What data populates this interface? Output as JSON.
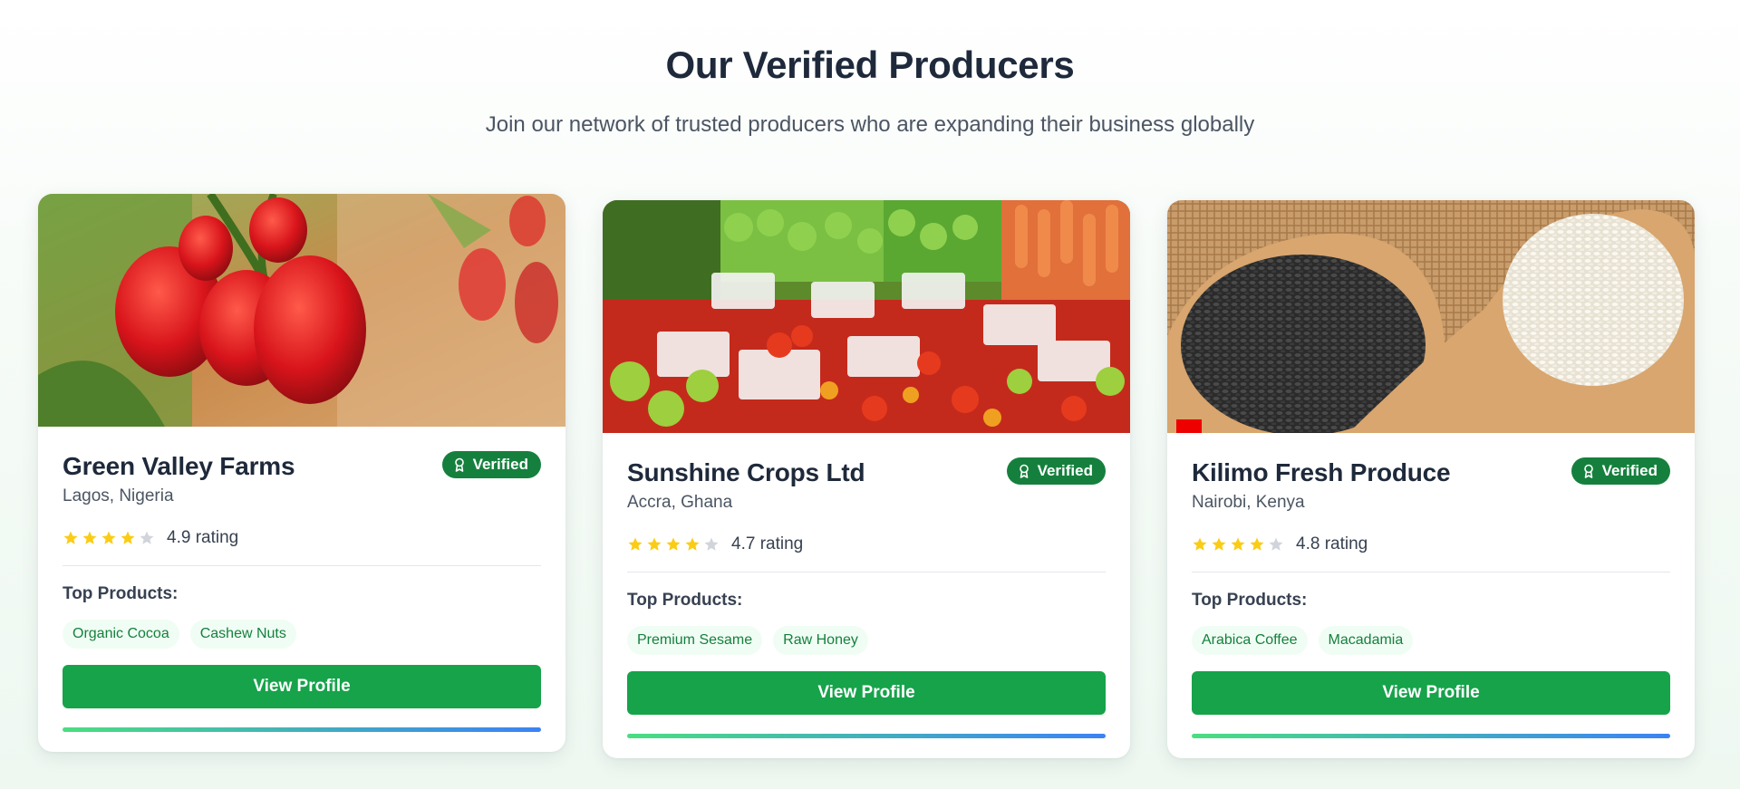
{
  "section": {
    "title": "Our Verified Producers",
    "subtitle": "Join our network of trusted producers who are expanding their business globally"
  },
  "producers": [
    {
      "name": "Green Valley Farms",
      "location": "Lagos, Nigeria",
      "badge": "Verified",
      "rating_text": "4.9 rating",
      "stars_filled": 4,
      "stars_total": 5,
      "products_label": "Top Products:",
      "products": [
        "Organic Cocoa",
        "Cashew Nuts"
      ],
      "button": "View Profile",
      "image": "red-bell-peppers-photo"
    },
    {
      "name": "Sunshine Crops Ltd",
      "location": "Accra, Ghana",
      "badge": "Verified",
      "rating_text": "4.7 rating",
      "stars_filled": 4,
      "stars_total": 5,
      "products_label": "Top Products:",
      "products": [
        "Premium Sesame",
        "Raw Honey"
      ],
      "button": "View Profile",
      "image": "vegetable-market-photo"
    },
    {
      "name": "Kilimo Fresh Produce",
      "location": "Nairobi, Kenya",
      "badge": "Verified",
      "rating_text": "4.8 rating",
      "stars_filled": 4,
      "stars_total": 5,
      "products_label": "Top Products:",
      "products": [
        "Arabica Coffee",
        "Macadamia"
      ],
      "button": "View Profile",
      "image": "sesame-seeds-spoons-photo"
    }
  ],
  "colors": {
    "accent": "#16a34a",
    "badge": "#15803d",
    "star_filled": "#facc15",
    "star_empty": "#d1d5db",
    "tag_bg": "#f0fdf4"
  }
}
